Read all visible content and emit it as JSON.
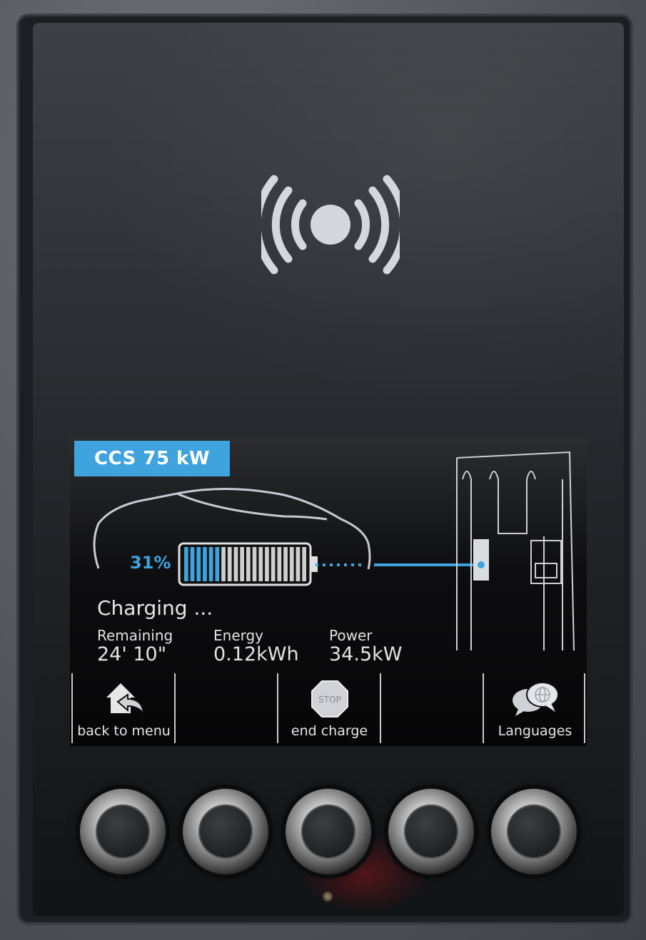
{
  "connector": {
    "label": "CCS 75 kW"
  },
  "battery": {
    "percent_label": "31%",
    "charge_fraction": 0.31
  },
  "status": {
    "text": "Charging ..."
  },
  "metrics": [
    {
      "label": "Remaining",
      "value": "24' 10\""
    },
    {
      "label": "Energy",
      "value": "0.12kWh"
    },
    {
      "label": "Power",
      "value": "34.5kW"
    }
  ],
  "softkeys": {
    "back": "back to menu",
    "end": "end charge",
    "languages": "Languages",
    "stop_sign_text": "STOP"
  },
  "colors": {
    "accent": "#3fa3dd",
    "screen_bg": "#0d0d0f",
    "text": "#e6e6e6"
  },
  "icons": [
    "nfc-contactless-icon",
    "car-outline-icon",
    "battery-icon",
    "charger-station-icon",
    "home-back-icon",
    "stop-sign-icon",
    "globe-chat-icon"
  ]
}
